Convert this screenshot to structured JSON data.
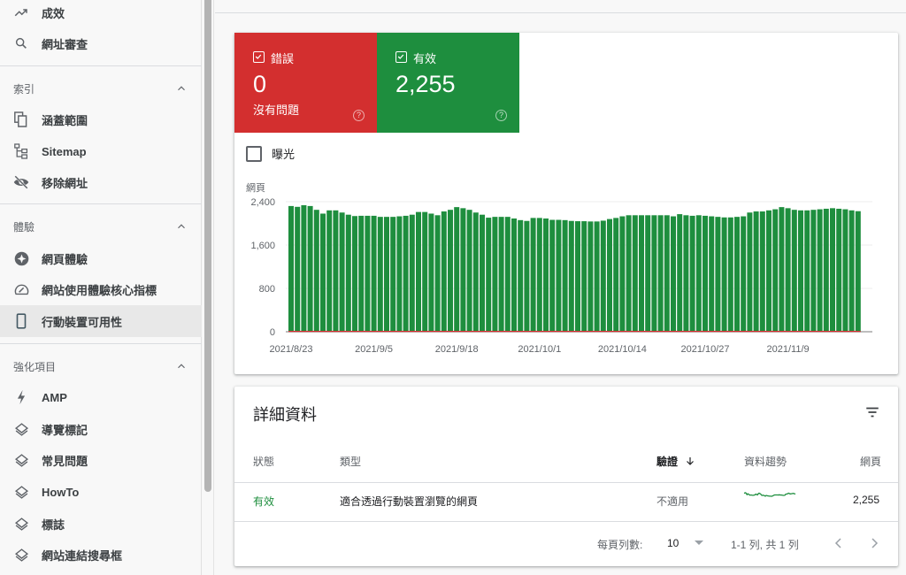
{
  "sidebar": {
    "top_items": [
      {
        "label": "成效",
        "icon": "trending-up-icon"
      },
      {
        "label": "網址審查",
        "icon": "search-icon"
      }
    ],
    "sections": [
      {
        "title": "索引",
        "items": [
          {
            "label": "涵蓋範圍",
            "icon": "coverage-icon"
          },
          {
            "label": "Sitemap",
            "icon": "sitemap-icon"
          },
          {
            "label": "移除網址",
            "icon": "visibility-off-icon"
          }
        ]
      },
      {
        "title": "體驗",
        "items": [
          {
            "label": "網頁體驗",
            "icon": "page-experience-icon"
          },
          {
            "label": "網站使用體驗核心指標",
            "icon": "speed-gauge-icon"
          },
          {
            "label": "行動裝置可用性",
            "icon": "smartphone-icon",
            "active": true
          }
        ]
      },
      {
        "title": "強化項目",
        "items": [
          {
            "label": "AMP",
            "icon": "bolt-icon"
          },
          {
            "label": "導覽標記",
            "icon": "layers-icon"
          },
          {
            "label": "常見問題",
            "icon": "layers-icon"
          },
          {
            "label": "HowTo",
            "icon": "layers-icon"
          },
          {
            "label": "標誌",
            "icon": "layers-icon"
          },
          {
            "label": "網站連結搜尋框",
            "icon": "layers-icon"
          }
        ]
      }
    ]
  },
  "summary": {
    "error_tile": {
      "label": "錯誤",
      "value": "0",
      "sub": "沒有問題",
      "help": "?",
      "color": "#d32f2f",
      "checked": true
    },
    "valid_tile": {
      "label": "有效",
      "value": "2,255",
      "help": "?",
      "color": "#1e8e3e",
      "checked": true
    },
    "impressions": {
      "label": "曝光",
      "checked": false
    }
  },
  "chart_data": {
    "type": "bar",
    "title": "",
    "ylabel": "網頁",
    "xlabel": "",
    "ylim": [
      0,
      2400
    ],
    "yticks": [
      "0",
      "800",
      "1,600",
      "2,400"
    ],
    "ytick_values": [
      0,
      800,
      1600,
      2400
    ],
    "xtick_labels": [
      "2021/8/23",
      "2021/9/5",
      "2021/9/18",
      "2021/10/1",
      "2021/10/14",
      "2021/10/27",
      "2021/11/9"
    ],
    "xtick_indices": [
      0,
      13,
      26,
      39,
      52,
      65,
      78
    ],
    "grid": true,
    "series": [
      {
        "name": "有效",
        "color": "#1e8e3e",
        "values": [
          2320,
          2305,
          2335,
          2320,
          2250,
          2180,
          2240,
          2240,
          2200,
          2160,
          2135,
          2140,
          2140,
          2140,
          2120,
          2120,
          2120,
          2130,
          2140,
          2160,
          2210,
          2210,
          2180,
          2150,
          2220,
          2250,
          2300,
          2280,
          2250,
          2200,
          2160,
          2105,
          2120,
          2120,
          2120,
          2090,
          2060,
          2045,
          2100,
          2100,
          2090,
          2065,
          2065,
          2060,
          2045,
          2040,
          2040,
          2035,
          2035,
          2050,
          2080,
          2100,
          2130,
          2150,
          2150,
          2150,
          2150,
          2150,
          2150,
          2150,
          2130,
          2170,
          2150,
          2140,
          2150,
          2140,
          2130,
          2120,
          2110,
          2110,
          2120,
          2130,
          2200,
          2220,
          2220,
          2240,
          2260,
          2300,
          2280,
          2250,
          2240,
          2240,
          2250,
          2260,
          2270,
          2280,
          2270,
          2260,
          2240,
          2225
        ],
        "start_date": "2021/8/23",
        "end_date": "2021/11/20"
      },
      {
        "name": "錯誤",
        "color": "#d32f2f",
        "values_all": 0
      }
    ]
  },
  "details": {
    "title": "詳細資料",
    "columns": {
      "status": "狀態",
      "type": "類型",
      "validation": "驗證",
      "trend": "資料趨勢",
      "pages": "網頁"
    },
    "sort_icon": "arrow-down-icon",
    "rows": [
      {
        "status": "有效",
        "type": "適合透過行動裝置瀏覽的網頁",
        "validation": "不適用",
        "pages": "2,255"
      }
    ],
    "pagination": {
      "rows_per_page_label": "每頁列數:",
      "rows_per_page": "10",
      "range": "1-1 列, 共 1 列"
    }
  }
}
